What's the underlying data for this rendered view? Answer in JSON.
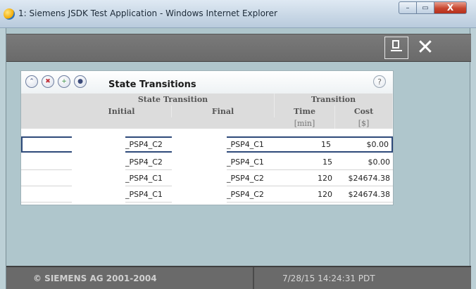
{
  "window": {
    "title": "1: Siemens JSDK Test Application - Windows Internet Explorer",
    "minimize_glyph": "–",
    "maximize_glyph": "▭",
    "close_glyph": "X"
  },
  "toolbar": {
    "export_icon": "export-icon",
    "close_glyph": "✕"
  },
  "panel": {
    "title": "State Transitions",
    "help_glyph": "?",
    "header_icons": [
      "collapse-icon",
      "delete-icon",
      "add-icon",
      "user-icon"
    ],
    "header_icon_glyphs": [
      "⌃",
      "✖",
      "+",
      "●"
    ]
  },
  "table": {
    "group_headers": {
      "state_transition": "State Transition",
      "transition": "Transition"
    },
    "columns": {
      "initial": "Initial",
      "final": "Final",
      "time": "Time",
      "cost": "Cost"
    },
    "units": {
      "time": "[min]",
      "cost": "[$]"
    },
    "rows": [
      {
        "initial": "_PSP4_C2",
        "final": "_PSP4_C1",
        "time": "15",
        "cost": "$0.00",
        "selected": true
      },
      {
        "initial": "_PSP4_C2",
        "final": "_PSP4_C1",
        "time": "15",
        "cost": "$0.00",
        "selected": false
      },
      {
        "initial": "_PSP4_C1",
        "final": "_PSP4_C2",
        "time": "120",
        "cost": "$24674.38",
        "selected": false
      },
      {
        "initial": "_PSP4_C1",
        "final": "_PSP4_C2",
        "time": "120",
        "cost": "$24674.38",
        "selected": false
      }
    ]
  },
  "statusbar": {
    "copyright": "© SIEMENS AG 2001-2004",
    "timestamp": "7/28/15 14:24:31 PDT"
  },
  "colors": {
    "accent_selection": "#2e4a7a",
    "toolbar": "#6a6a6a",
    "background": "#afc6cc"
  }
}
